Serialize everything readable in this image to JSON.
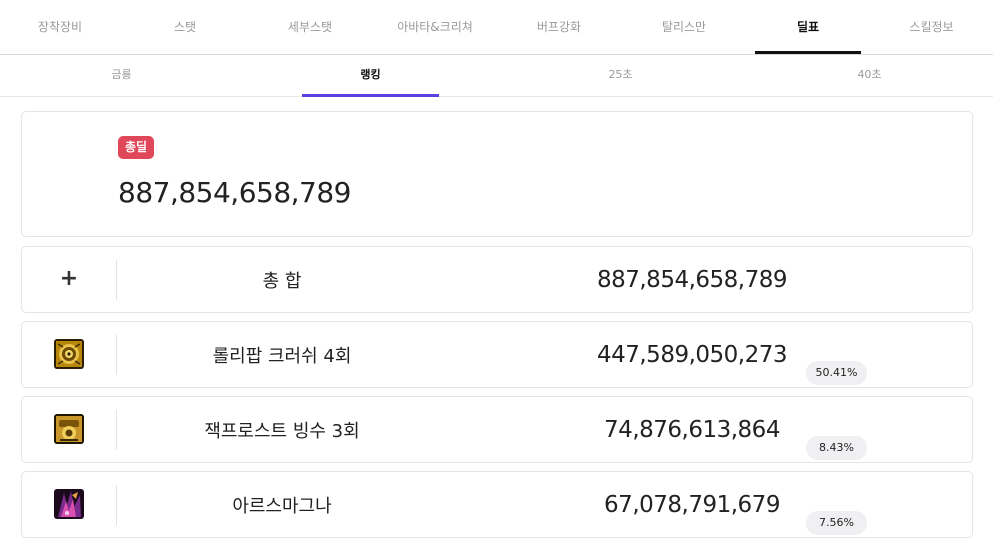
{
  "top_tabs": [
    {
      "label": "장착장비"
    },
    {
      "label": "스탯"
    },
    {
      "label": "세부스탯"
    },
    {
      "label": "아바타&크리쳐"
    },
    {
      "label": "버프강화"
    },
    {
      "label": "탈리스만"
    },
    {
      "label": "딜표"
    },
    {
      "label": "스킬정보"
    }
  ],
  "active_top_tab": "딜표",
  "sub_tabs": [
    {
      "label": "금룡"
    },
    {
      "label": "랭킹"
    },
    {
      "label": "25초"
    },
    {
      "label": "40초"
    }
  ],
  "active_sub_tab": "랭킹",
  "summary": {
    "badge": "총딜",
    "value": "887,854,658,789"
  },
  "rows": [
    {
      "icon": "plus-icon",
      "name": "총 합",
      "value": "887,854,658,789"
    },
    {
      "icon": "lollipop-crush-skill-icon",
      "name": "롤리팝 크러쉬 4회",
      "value": "447,589,050,273",
      "percent": "50.41%"
    },
    {
      "icon": "jack-frost-skill-icon",
      "name": "잭프로스트 빙수 3회",
      "value": "74,876,613,864",
      "percent": "8.43%"
    },
    {
      "icon": "ars-magna-skill-icon",
      "name": "아르스마그나",
      "value": "67,078,791,679",
      "percent": "7.56%"
    }
  ],
  "colors": {
    "badge": "#e0485a",
    "sub_tab_accent": "#5b3fe0",
    "top_tab_accent": "#111111"
  }
}
